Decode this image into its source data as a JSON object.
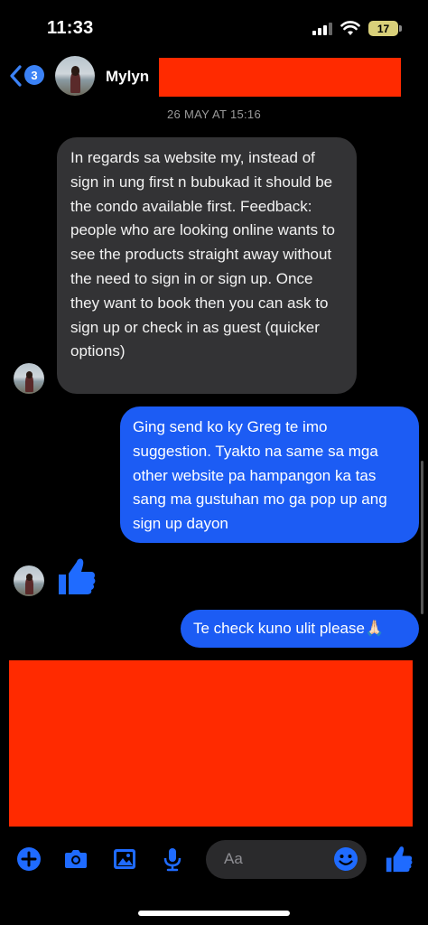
{
  "status_bar": {
    "time": "11:33",
    "battery": "17"
  },
  "header": {
    "back_count": "3",
    "contact_name": "Mylyn"
  },
  "thread": {
    "timestamp": "26 MAY AT 15:16",
    "incoming_message": "In regards sa website my, instead of sign in ung first n bubukad it should be the condo available first. Feedback: people who are looking online wants to see the products straight away without the need to sign in or sign up. Once they want to book then you can ask to sign up or check in as guest (quicker options)",
    "outgoing_message_1": "Ging send ko ky Greg te imo suggestion. Tyakto na same sa mga other website pa hampangon ka tas sang ma gustuhan mo ga pop up ang sign up dayon",
    "outgoing_message_2": "Te check kuno ulit please🙏🏻"
  },
  "composer": {
    "placeholder": "Aa"
  },
  "colors": {
    "accent": "#1c5cf4",
    "incoming_bubble": "#333335",
    "redaction": "#ff2a00",
    "background": "#000000"
  },
  "icons": [
    "back-chevron-icon",
    "plus-icon",
    "camera-icon",
    "image-icon",
    "microphone-icon",
    "emoji-icon",
    "thumbs-up-icon",
    "signal-icon",
    "wifi-icon",
    "battery-icon"
  ]
}
